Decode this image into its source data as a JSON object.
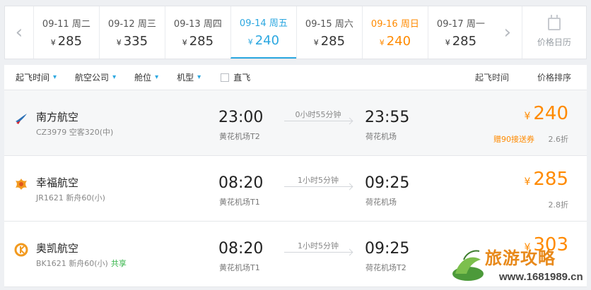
{
  "date_bar": {
    "prev_arrow": "‹",
    "next_arrow": "›",
    "currency": "¥",
    "dates": [
      {
        "date": "09-11 周二",
        "price": "285"
      },
      {
        "date": "09-12 周三",
        "price": "335"
      },
      {
        "date": "09-13 周四",
        "price": "285"
      },
      {
        "date": "09-14 周五",
        "price": "240"
      },
      {
        "date": "09-15 周六",
        "price": "285"
      },
      {
        "date": "09-16 周日",
        "price": "240"
      },
      {
        "date": "09-17 周一",
        "price": "285"
      }
    ],
    "calendar_label": "价格日历"
  },
  "filters": {
    "items": [
      "起飞时间",
      "航空公司",
      "舱位",
      "机型"
    ],
    "direct_label": "直飞",
    "sort_depart": "起飞时间",
    "sort_price": "价格排序"
  },
  "flights": [
    {
      "airline": "南方航空",
      "flight_no": "CZ3979 空客320(中)",
      "share": "",
      "dep_time": "23:00",
      "dep_airport": "黄花机场T2",
      "duration": "0小时55分钟",
      "arr_time": "23:55",
      "arr_airport": "荷花机场",
      "price": "240",
      "promo": "赠90接送券",
      "discount": "2.6折"
    },
    {
      "airline": "幸福航空",
      "flight_no": "JR1621 新舟60(小)",
      "share": "",
      "dep_time": "08:20",
      "dep_airport": "黄花机场T1",
      "duration": "1小时5分钟",
      "arr_time": "09:25",
      "arr_airport": "荷花机场",
      "price": "285",
      "promo": "",
      "discount": "2.8折"
    },
    {
      "airline": "奥凯航空",
      "flight_no": "BK1621 新舟60(小)",
      "share": "共享",
      "dep_time": "08:20",
      "dep_airport": "黄花机场T1",
      "duration": "1小时5分钟",
      "arr_time": "09:25",
      "arr_airport": "荷花机场T2",
      "price": "303",
      "promo": "",
      "discount": ""
    }
  ],
  "watermark": {
    "title": "旅游攻略",
    "url": "www.1681989.cn"
  },
  "colors": {
    "accent": "#2ba7e0",
    "price": "#ff8a00",
    "share": "#36b44a"
  }
}
